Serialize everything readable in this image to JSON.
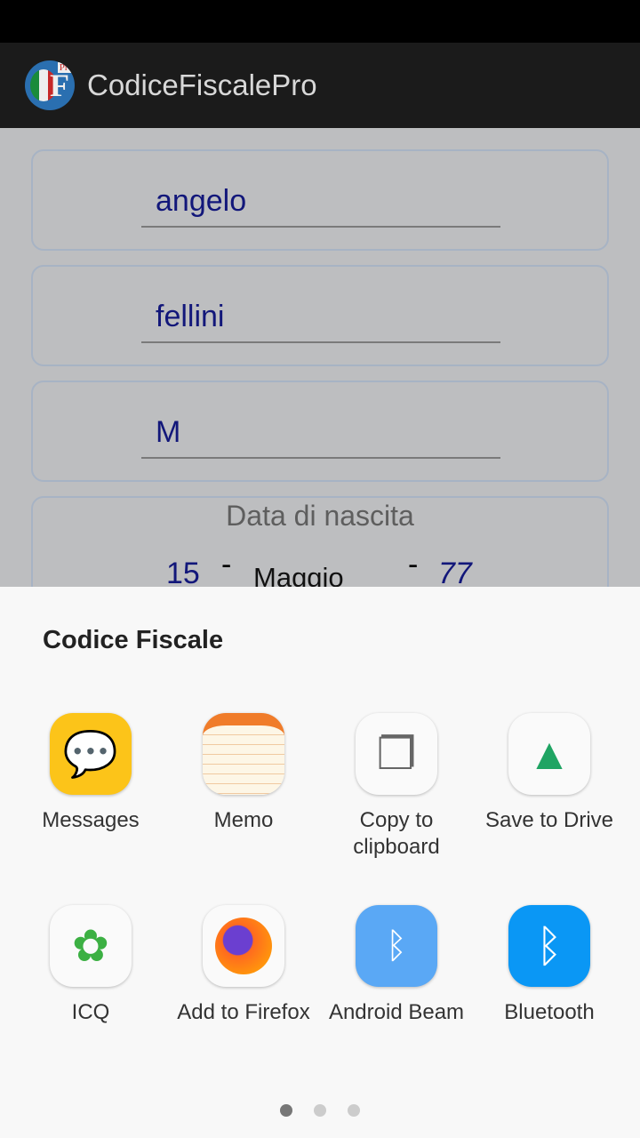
{
  "appbar": {
    "title": "CodiceFiscalePro",
    "logo_text": "CF Pro"
  },
  "form": {
    "name": "angelo",
    "surname": "fellini",
    "sex": "M",
    "birth_label": "Data di nascita",
    "day": "15",
    "sep": "-",
    "month": "Maggio",
    "year": "77"
  },
  "share": {
    "title": "Codice Fiscale",
    "apps": [
      {
        "label": "Messages",
        "icon": "messages-icon"
      },
      {
        "label": "Memo",
        "icon": "memo-icon"
      },
      {
        "label": "Copy to clipboard",
        "icon": "copy-icon"
      },
      {
        "label": "Save to Drive",
        "icon": "drive-icon"
      },
      {
        "label": "ICQ",
        "icon": "icq-icon"
      },
      {
        "label": "Add to Firefox",
        "icon": "firefox-icon"
      },
      {
        "label": "Android Beam",
        "icon": "android-beam-icon"
      },
      {
        "label": "Bluetooth",
        "icon": "bluetooth-icon"
      }
    ],
    "page": 1,
    "pages": 3
  }
}
